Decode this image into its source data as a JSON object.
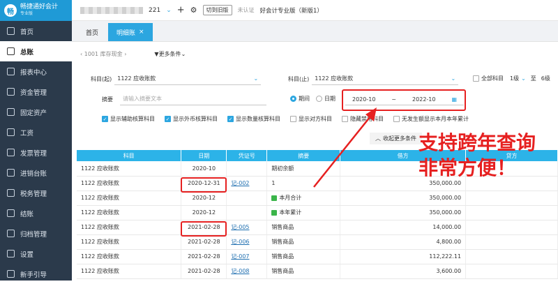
{
  "app": {
    "title": "畅捷通好会计",
    "subtitle": "专业版"
  },
  "topbar": {
    "period": "221",
    "switch_label": "切到旧版",
    "cert": "未认证",
    "company": "好会计专业版（新版1）"
  },
  "sidebar": {
    "items": [
      {
        "label": "首页",
        "icon": "home-icon"
      },
      {
        "label": "总账",
        "icon": "ledger-icon"
      },
      {
        "label": "报表中心",
        "icon": "report-icon"
      },
      {
        "label": "资金管理",
        "icon": "money-icon"
      },
      {
        "label": "固定资产",
        "icon": "asset-icon"
      },
      {
        "label": "工资",
        "icon": "salary-icon"
      },
      {
        "label": "发票管理",
        "icon": "invoice-icon"
      },
      {
        "label": "进销台账",
        "icon": "stock-icon"
      },
      {
        "label": "税务管理",
        "icon": "tax-icon"
      },
      {
        "label": "结账",
        "icon": "close-icon"
      },
      {
        "label": "归档管理",
        "icon": "archive-icon"
      },
      {
        "label": "设置",
        "icon": "gear-icon"
      },
      {
        "label": "新手引导",
        "icon": "guide-icon"
      }
    ]
  },
  "tabs": [
    {
      "label": "首页"
    },
    {
      "label": "明细账"
    }
  ],
  "crumbs": {
    "account": "1001 库存现金",
    "more": "更多条件"
  },
  "filter": {
    "subject_from_label": "科目(起)",
    "subject_from": "1122 应收账款",
    "subject_to_label": "科目(止)",
    "subject_to": "1122 应收账款",
    "all_subjects": "全部科目",
    "level_from": "1级",
    "to": "至",
    "level_to": "6级",
    "memo_label": "摘要",
    "memo_placeholder": "请输入摘要文本",
    "period_label": "期间",
    "date_label": "日期",
    "date_from": "2020-10",
    "date_sep": "~",
    "date_to": "2022-10",
    "checks": [
      "显示辅助核算科目",
      "显示外币核算科目",
      "显示数量核算科目",
      "显示对方科目",
      "隐藏禁用科目",
      "无发生额显示本月本年累计"
    ],
    "collapse": "收起更多条件"
  },
  "table": {
    "headers": [
      "科目",
      "日期",
      "凭证号",
      "摘要",
      "借方",
      "贷方"
    ],
    "rows": [
      [
        "1122 应收账款",
        "2020-10",
        "",
        "期初余额",
        "",
        ""
      ],
      [
        "1122 应收账款",
        "2020-12-31",
        "记-002",
        "1",
        "350,000.00",
        ""
      ],
      [
        "1122 应收账款",
        "2020-12",
        "",
        "本月合计",
        "350,000.00",
        ""
      ],
      [
        "1122 应收账款",
        "2020-12",
        "",
        "本年累计",
        "350,000.00",
        ""
      ],
      [
        "1122 应收账款",
        "2021-02-28",
        "记-005",
        "销售商品",
        "14,000.00",
        ""
      ],
      [
        "1122 应收账款",
        "2021-02-28",
        "记-006",
        "销售商品",
        "4,800.00",
        ""
      ],
      [
        "1122 应收账款",
        "2021-02-28",
        "记-007",
        "销售商品",
        "112,222.11",
        ""
      ],
      [
        "1122 应收账款",
        "2021-02-28",
        "记-008",
        "销售商品",
        "3,600.00",
        ""
      ]
    ]
  },
  "annotation": {
    "line1": "支持跨年查询",
    "line2": "非常方便！"
  },
  "colors": {
    "accent": "#2ca6e0",
    "sidebar": "#2b3a4b",
    "highlight": "#e62020"
  }
}
